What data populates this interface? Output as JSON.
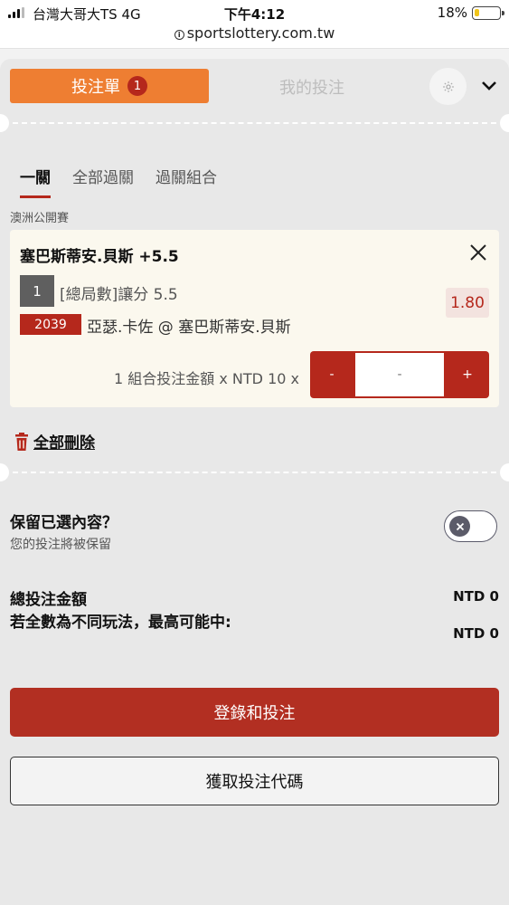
{
  "status_bar": {
    "carrier": "台灣大哥大TS  4G",
    "time": "下午4:12",
    "battery_percent_text": "18%",
    "battery_level": 0.18,
    "url": "sportslottery.com.tw"
  },
  "header": {
    "bet_slip_tab": "投注單",
    "bet_slip_count": "1",
    "my_bets_tab": "我的投注"
  },
  "sub_tabs": [
    "一關",
    "全部過關",
    "過關組合"
  ],
  "league": "澳洲公開賽",
  "bet": {
    "selection": "塞巴斯蒂安.貝斯 +5.5",
    "leg_number": "1",
    "market": "[總局數]讓分 5.5",
    "odds": "1.80",
    "game_code": "2039",
    "event": "亞瑟.卡佐 @ 塞巴斯蒂安.貝斯",
    "stake_label": "1 組合投注金額 x NTD 10 x",
    "stake_minus": "-",
    "stake_placeholder": "-",
    "stake_plus": "+"
  },
  "delete_all": "全部刪除",
  "keep_selection": {
    "title": "保留已選內容？",
    "subtitle": "您的投注將被保留"
  },
  "totals": {
    "total_label": "總投注金額",
    "total_value": "NTD 0",
    "max_win_label": "若全數為不同玩法，最高可能中:",
    "max_win_value": "NTD 0"
  },
  "buttons": {
    "login_and_bet": "登錄和投注",
    "get_bet_code": "獲取投注代碼"
  },
  "colors": {
    "accent_orange": "#ee7e32",
    "primary_red": "#b5281c"
  }
}
